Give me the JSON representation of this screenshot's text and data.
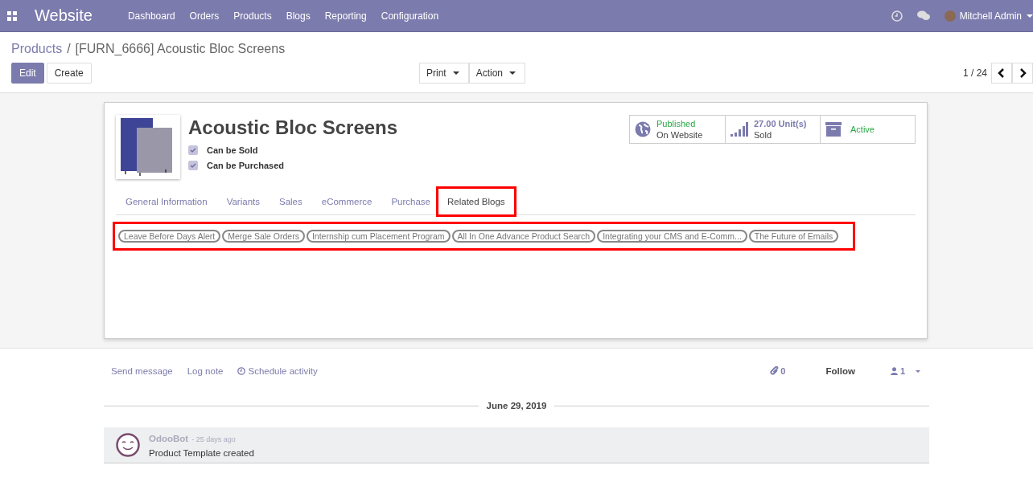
{
  "navbar": {
    "app_title": "Website",
    "menu": [
      "Dashboard",
      "Orders",
      "Products",
      "Blogs",
      "Reporting",
      "Configuration"
    ],
    "user": "Mitchell Admin"
  },
  "breadcrumb": {
    "parent": "Products",
    "separator": "/",
    "current": "[FURN_6666] Acoustic Bloc Screens"
  },
  "buttons": [
    {
      "label": "Edit",
      "kind": "primary"
    },
    {
      "label": "Create",
      "kind": "secondary"
    }
  ],
  "dropdowns": [
    "Print",
    "Action"
  ],
  "pager": "1 / 24",
  "product": {
    "name": "Acoustic Bloc Screens",
    "options": [
      {
        "label": "Can be Sold",
        "checked": true
      },
      {
        "label": "Can be Purchased",
        "checked": true
      }
    ]
  },
  "smart_buttons": [
    {
      "kind": "website",
      "line1": "Published",
      "line2": "On Website"
    },
    {
      "kind": "sold",
      "line1": "27.00 Unit(s)",
      "line2": "Sold"
    },
    {
      "kind": "active",
      "line1": "Active"
    }
  ],
  "tabs": [
    {
      "label": "General Information",
      "selected": false,
      "highlighted": false
    },
    {
      "label": "Variants",
      "selected": false,
      "highlighted": false
    },
    {
      "label": "Sales",
      "selected": false,
      "highlighted": false
    },
    {
      "label": "eCommerce",
      "selected": false,
      "highlighted": false
    },
    {
      "label": "Purchase",
      "selected": false,
      "highlighted": false
    },
    {
      "label": "Related Blogs",
      "selected": true,
      "highlighted": true
    }
  ],
  "related_blogs": {
    "highlighted": true,
    "tags": [
      "Leave Before Days Alert",
      "Merge Sale Orders",
      "Internship cum Placement Program",
      "All In One Advance Product Search",
      "Integrating your CMS and E-Comm...",
      "The Future of Emails"
    ]
  },
  "chatter": {
    "actions": [
      "Send message",
      "Log note",
      "Schedule activity"
    ],
    "attachments": "0",
    "follow": "Follow",
    "followers": "1",
    "date": "June 29, 2019",
    "messages": [
      {
        "author": "OdooBot",
        "time": "- 25 days ago",
        "body": "Product Template created"
      }
    ]
  }
}
